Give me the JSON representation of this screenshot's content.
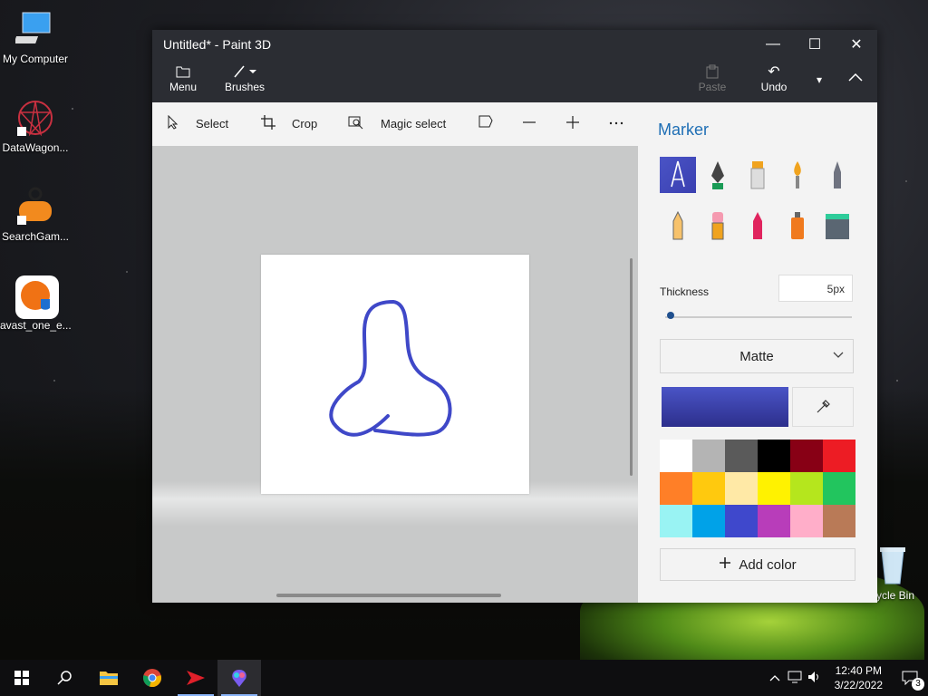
{
  "desktop": {
    "icons": [
      {
        "label": "My Computer"
      },
      {
        "label": "DataWagon..."
      },
      {
        "label": "SearchGam..."
      },
      {
        "label": "avast_one_e..."
      }
    ],
    "recycle_bin": "cycle Bin"
  },
  "window": {
    "title": "Untitled* - Paint 3D",
    "controls": {
      "minimize": "—",
      "maximize": "☐",
      "close": "✕"
    },
    "ribbon": {
      "menu": "Menu",
      "brushes": "Brushes",
      "paste": "Paste",
      "undo": "Undo"
    },
    "toolbar": {
      "select": "Select",
      "crop": "Crop",
      "magic_select": "Magic select"
    }
  },
  "panel": {
    "title": "Marker",
    "thickness_label": "Thickness",
    "thickness_value": "5px",
    "thickness_level": 0.03,
    "finish": "Matte",
    "current_color": "#3f48c8",
    "add_color": "Add color",
    "brushes": [
      {
        "name": "marker",
        "selected": true
      },
      {
        "name": "calligraphy-pen"
      },
      {
        "name": "oil-brush"
      },
      {
        "name": "watercolor"
      },
      {
        "name": "pixel-pen"
      },
      {
        "name": "pencil"
      },
      {
        "name": "eraser"
      },
      {
        "name": "crayon"
      },
      {
        "name": "spray-can"
      },
      {
        "name": "fill"
      }
    ],
    "palette": [
      "#ffffff",
      "#b4b4b4",
      "#5a5a5a",
      "#000000",
      "#880015",
      "#ed1c24",
      "#ff7f27",
      "#ffc90e",
      "#ffe9a6",
      "#fff200",
      "#b5e61d",
      "#22c55e",
      "#99f3f3",
      "#00a2e8",
      "#3f48cc",
      "#b83dba",
      "#ffaec9",
      "#b97a57"
    ]
  },
  "taskbar": {
    "time": "12:40 PM",
    "date": "3/22/2022",
    "notifications": "3"
  }
}
